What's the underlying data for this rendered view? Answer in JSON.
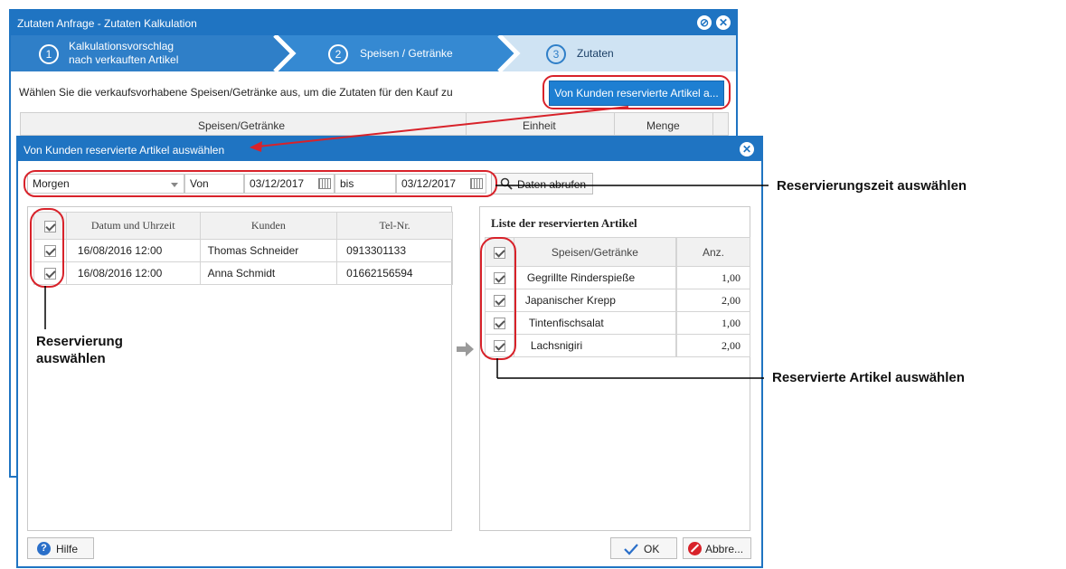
{
  "back_window": {
    "title": "Zutaten Anfrage - Zutaten Kalkulation",
    "steps": [
      {
        "num": "1",
        "label_line1": "Kalkulationsvorschlag",
        "label_line2": "nach verkauften Artikel"
      },
      {
        "num": "2",
        "label": "Speisen / Getränke"
      },
      {
        "num": "3",
        "label": "Zutaten"
      }
    ],
    "instruction": "Wählen Sie die verkaufsvorhabene Speisen/Getränke aus, um die Zutaten für den Kauf zu",
    "reserved_button": "Von Kunden reservierte Artikel a...",
    "columns": [
      "Speisen/Getränke",
      "Einheit",
      "Menge"
    ]
  },
  "dialog": {
    "title": "Von Kunden reservierte Artikel auswählen",
    "period": "Morgen",
    "from_label": "Von",
    "from_date": "03/12/2017",
    "to_label": "bis",
    "to_date": "03/12/2017",
    "fetch_button": "Daten abrufen",
    "reservations": {
      "columns": [
        "Datum und Uhrzeit",
        "Kunden",
        "Tel-Nr."
      ],
      "rows": [
        {
          "datetime": "16/08/2016 12:00",
          "customer": "Thomas Schneider",
          "phone": "0913301133"
        },
        {
          "datetime": "16/08/2016 12:00",
          "customer": "Anna Schmidt",
          "phone": "01662156594"
        }
      ]
    },
    "items": {
      "title": "Liste der reservierten Artikel",
      "columns": [
        "Speisen/Getränke",
        "Anz."
      ],
      "rows": [
        {
          "name": "Gegrillte Rinderspieße",
          "qty": "1,00"
        },
        {
          "name": "Japanischer Krepp",
          "qty": "2,00"
        },
        {
          "name": "Tintenfischsalat",
          "qty": "1,00"
        },
        {
          "name": "Lachsnigiri",
          "qty": "2,00"
        }
      ]
    },
    "help_button": "Hilfe",
    "ok_button": "OK",
    "cancel_button": "Abbre..."
  },
  "annotations": {
    "time": "Reservierungszeit auswählen",
    "reservation_line1": "Reservierung",
    "reservation_line2": "auswählen",
    "items": "Reservierte Artikel auswählen"
  },
  "colors": {
    "titlebar": "#1f74c2",
    "step_active": "#2f86cf",
    "step_inactive": "#cfe3f3",
    "highlight": "#d8222a"
  }
}
